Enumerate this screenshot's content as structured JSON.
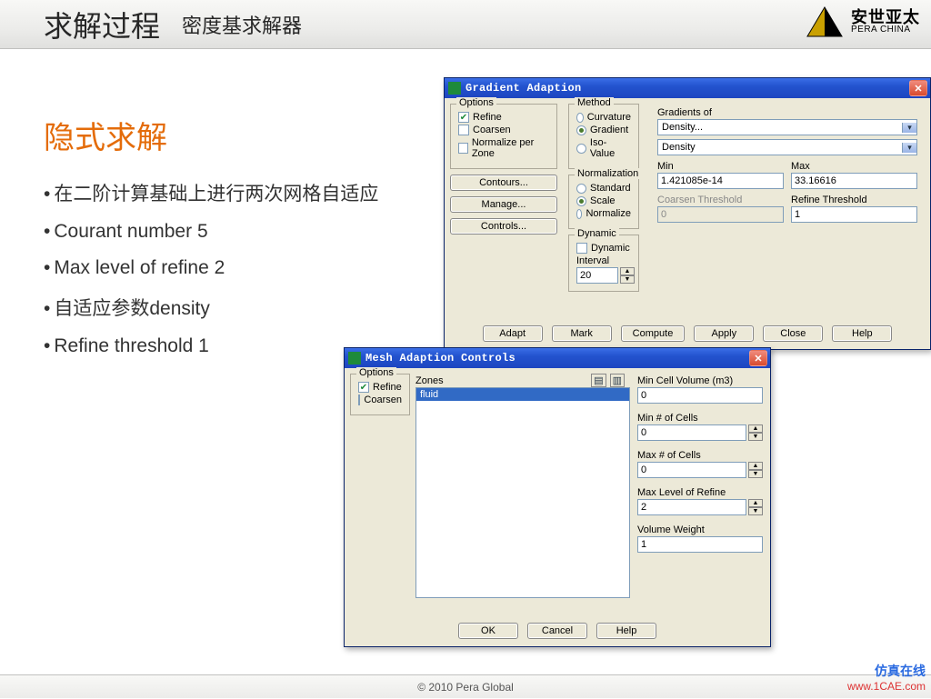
{
  "header": {
    "title": "求解过程",
    "subtitle": "密度基求解器"
  },
  "brand": {
    "cn": "安世亚太",
    "en": "PERA CHINA"
  },
  "slide": {
    "heading": "隐式求解",
    "bullets": [
      "在二阶计算基础上进行两次网格自适应",
      "Courant number 5",
      "Max level of refine 2",
      "自适应参数density",
      "Refine threshold 1"
    ]
  },
  "footer": {
    "copyright": "© 2010 Pera Global"
  },
  "watermark": {
    "line1": "仿真在线",
    "line2": "www.1CAE.com"
  },
  "grad": {
    "title": "Gradient Adaption",
    "options": {
      "legend": "Options",
      "refine": "Refine",
      "refine_checked": true,
      "coarsen": "Coarsen",
      "coarsen_checked": false,
      "normalize": "Normalize per Zone",
      "normalize_checked": false
    },
    "buttons_left": {
      "contours": "Contours...",
      "manage": "Manage...",
      "controls": "Controls..."
    },
    "method": {
      "legend": "Method",
      "curvature": "Curvature",
      "gradient": "Gradient",
      "iso": "Iso-Value",
      "selected": "gradient"
    },
    "normalization": {
      "legend": "Normalization",
      "standard": "Standard",
      "scale": "Scale",
      "normalize": "Normalize",
      "selected": "scale"
    },
    "dynamic": {
      "legend": "Dynamic",
      "dynamic": "Dynamic",
      "dynamic_checked": false,
      "interval_label": "Interval",
      "interval": "20"
    },
    "gradients_of": {
      "legend": "Gradients of",
      "combo1": "Density...",
      "combo2": "Density"
    },
    "min": {
      "label": "Min",
      "value": "1.421085e-14"
    },
    "max": {
      "label": "Max",
      "value": "33.16616"
    },
    "coarsen_thr": {
      "label": "Coarsen Threshold",
      "value": "0"
    },
    "refine_thr": {
      "label": "Refine Threshold",
      "value": "1"
    },
    "bottom": {
      "adapt": "Adapt",
      "mark": "Mark",
      "compute": "Compute",
      "apply": "Apply",
      "close": "Close",
      "help": "Help"
    }
  },
  "mesh": {
    "title": "Mesh Adaption Controls",
    "options": {
      "legend": "Options",
      "refine": "Refine",
      "refine_checked": true,
      "coarsen": "Coarsen",
      "coarsen_checked": false
    },
    "zones": {
      "legend": "Zones",
      "items": [
        "fluid"
      ],
      "selected": 0
    },
    "min_cell_vol": {
      "label": "Min Cell Volume (m3)",
      "value": "0"
    },
    "min_cells": {
      "label": "Min # of Cells",
      "value": "0"
    },
    "max_cells": {
      "label": "Max # of Cells",
      "value": "0"
    },
    "max_refine": {
      "label": "Max Level of Refine",
      "value": "2"
    },
    "vol_weight": {
      "label": "Volume Weight",
      "value": "1"
    },
    "bottom": {
      "ok": "OK",
      "cancel": "Cancel",
      "help": "Help"
    }
  }
}
